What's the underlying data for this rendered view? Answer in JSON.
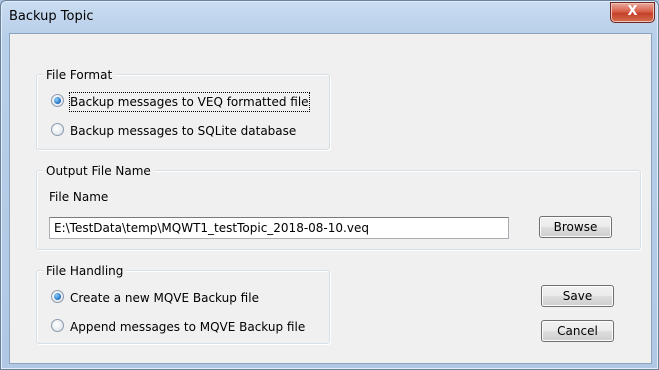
{
  "window": {
    "title": "Backup Topic",
    "close_glyph": "X"
  },
  "file_format": {
    "legend": "File Format",
    "options": [
      {
        "label": "Backup messages to VEQ formatted file",
        "checked": true
      },
      {
        "label": "Backup messages to SQLite database",
        "checked": false
      }
    ]
  },
  "output_file": {
    "legend": "Output File Name",
    "field_label": "File Name",
    "value": "E:\\TestData\\temp\\MQWT1_testTopic_2018-08-10.veq",
    "browse_label": "Browse"
  },
  "file_handling": {
    "legend": "File Handling",
    "options": [
      {
        "label": "Create a new MQVE Backup file",
        "checked": true
      },
      {
        "label": "Append messages to MQVE Backup file",
        "checked": false
      }
    ]
  },
  "buttons": {
    "save_label": "Save",
    "cancel_label": "Cancel"
  }
}
